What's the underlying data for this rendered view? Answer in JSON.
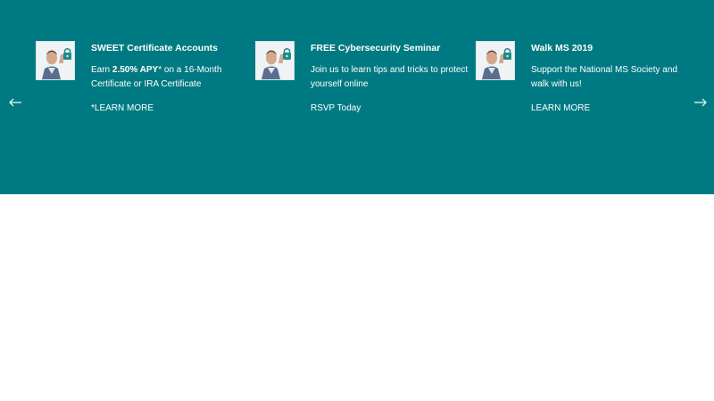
{
  "navigation": {
    "prev_icon": "arrow-left-icon",
    "next_icon": "arrow-right-icon"
  },
  "colors": {
    "banner_background": "#007a82",
    "text": "#ffffff",
    "page_background": "#ffffff"
  },
  "cards": [
    {
      "thumbnail_icon": "person-lock-photo",
      "title": "SWEET Certificate Accounts",
      "text_before": "Earn ",
      "text_bold": "2.50% APY",
      "text_after": "* on a 16-Month Certificate or IRA Certificate",
      "link": "*LEARN MORE"
    },
    {
      "thumbnail_icon": "person-lock-photo",
      "title": "FREE Cybersecurity Seminar",
      "text": "Join us to learn tips and tricks to protect yourself online",
      "link": "RSVP Today"
    },
    {
      "thumbnail_icon": "person-lock-photo",
      "title": "Walk MS 2019",
      "text": "Support the National MS Society and walk with us!",
      "link": "LEARN MORE"
    }
  ]
}
